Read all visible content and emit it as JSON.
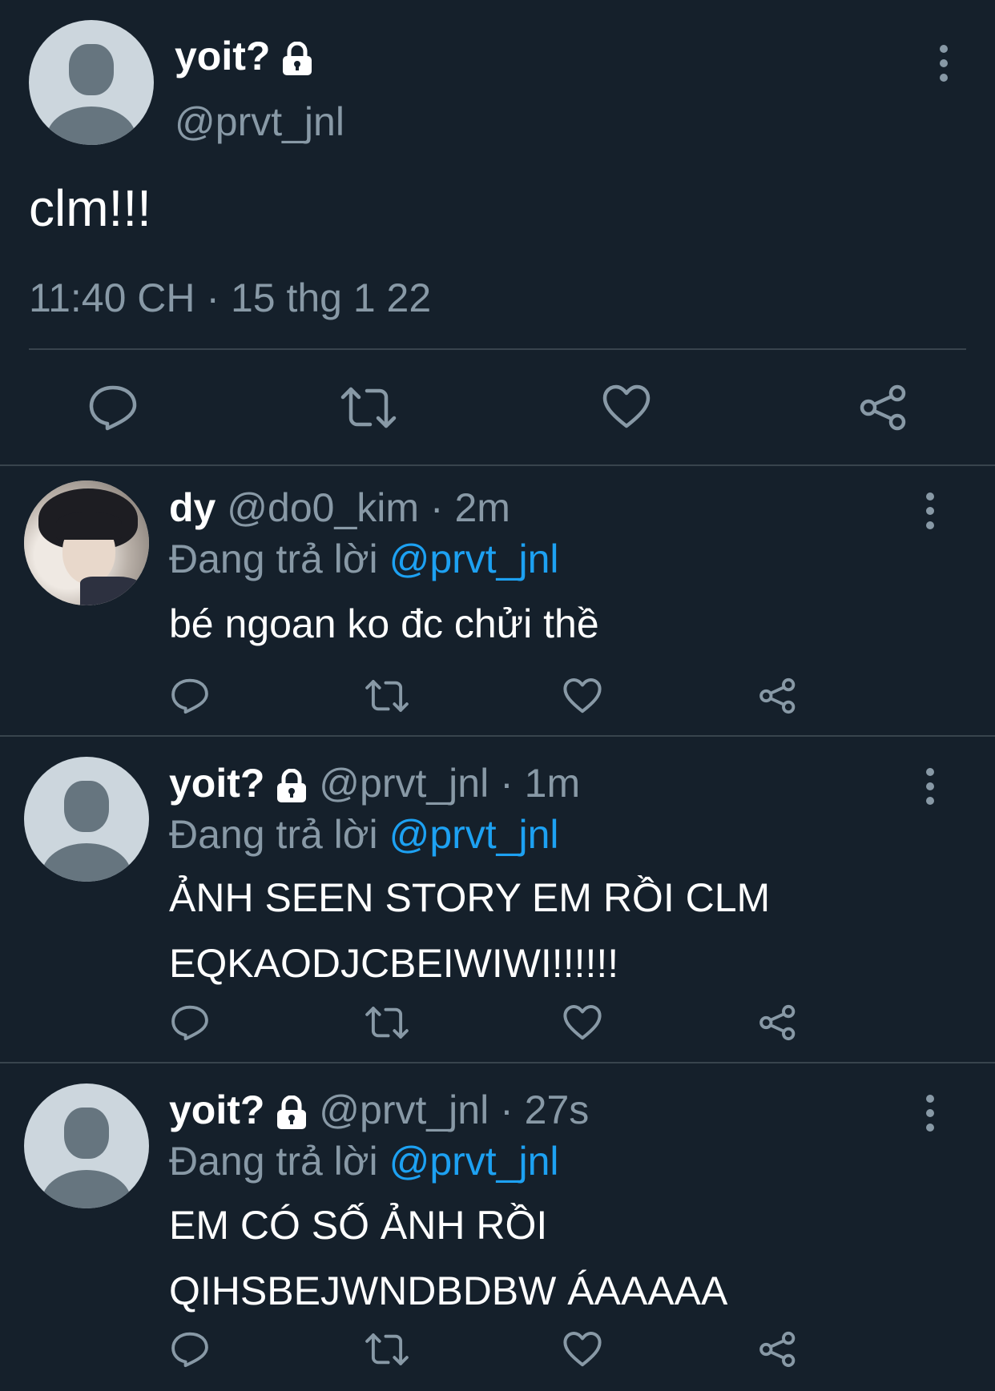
{
  "main_tweet": {
    "display_name": "yoit?",
    "handle": "@prvt_jnl",
    "text": "clm!!!",
    "timestamp": "11:40 CH · 15 thg 1 22",
    "protected_icon": "lock-icon"
  },
  "action_icons": [
    "reply-icon",
    "retweet-icon",
    "like-icon",
    "share-icon"
  ],
  "replies": [
    {
      "display_name": "dy",
      "handle": "@do0_kim",
      "time": "· 2m",
      "replying_prefix": "Đang trả lời",
      "replying_to": "@prvt_jnl",
      "text": "bé ngoan ko đc chửi thề",
      "protected": false
    },
    {
      "display_name": "yoit?",
      "handle": "@prvt_jnl",
      "time": "· 1m",
      "replying_prefix": "Đang trả lời",
      "replying_to": "@prvt_jnl",
      "text": "ẢNH SEEN STORY EM RỒI CLM\nEQKAODJCBEIWIWI!!!!!!",
      "protected": true
    },
    {
      "display_name": "yoit?",
      "handle": "@prvt_jnl",
      "time": "· 27s",
      "replying_prefix": "Đang trả lời",
      "replying_to": "@prvt_jnl",
      "text": "EM CÓ SỐ ẢNH RỒI\nQIHSBEJWNDBDBW ÁAAAAA",
      "protected": true
    }
  ],
  "colors": {
    "background": "#15202b",
    "muted": "#8899a6",
    "link": "#1da1f2",
    "divider": "#38444d"
  }
}
